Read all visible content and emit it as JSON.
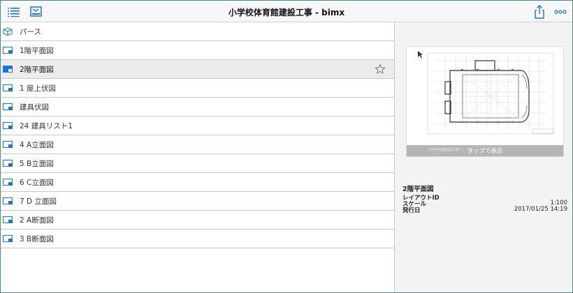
{
  "header": {
    "title": "小学校体育館建設工事 - bimx",
    "icons": {
      "left1": "list-icon",
      "left2": "layout-icon",
      "right1": "share-icon",
      "right2": "more-icon"
    }
  },
  "list": {
    "items": [
      {
        "label": "パース",
        "icon": "perspective-cube-icon"
      },
      {
        "label": "1階平面図",
        "icon": "layout-sheet-icon"
      },
      {
        "label": "2階平面図",
        "icon": "layout-sheet-icon",
        "selected": true
      },
      {
        "label": "1 屋上伏図",
        "icon": "layout-sheet-icon"
      },
      {
        "label": "建具伏図",
        "icon": "layout-sheet-icon"
      },
      {
        "label": "24 建具リスト1",
        "icon": "layout-sheet-icon"
      },
      {
        "label": "4 A立面図",
        "icon": "layout-sheet-icon"
      },
      {
        "label": "5 B立面図",
        "icon": "layout-sheet-icon"
      },
      {
        "label": "6 C立面図",
        "icon": "layout-sheet-icon"
      },
      {
        "label": "7 D 立面図",
        "icon": "layout-sheet-icon"
      },
      {
        "label": "2 A断面図",
        "icon": "layout-sheet-icon"
      },
      {
        "label": "3 B断面図",
        "icon": "layout-sheet-icon"
      }
    ]
  },
  "preview": {
    "tap_label": "タップで表示",
    "sheet_caption": "小学校体育館建設工事"
  },
  "info": {
    "title": "2階平面図",
    "layout_id_label": "レイアウトID",
    "layout_id_value": "",
    "scale_label": "スケール",
    "scale_value": "1:100",
    "issue_date_label": "発行日",
    "issue_date_value": "2017/01/25 14:19"
  },
  "colors": {
    "accent": "#1a73d6",
    "frame": "#4a8c8a"
  }
}
